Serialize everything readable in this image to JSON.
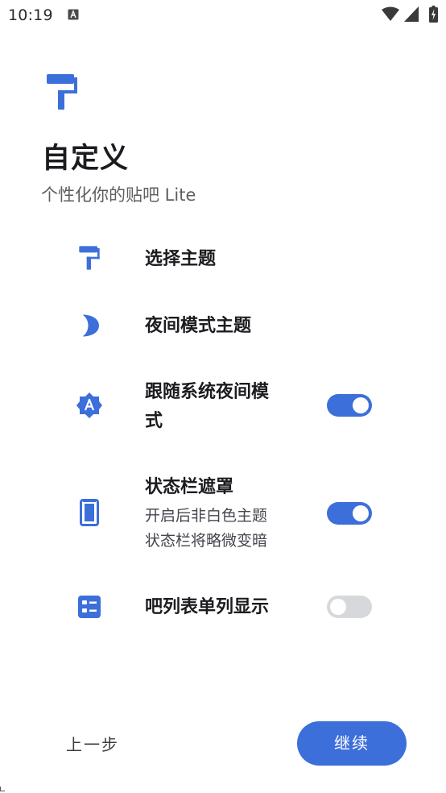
{
  "status_bar": {
    "time": "10:19",
    "notification_icon": "text-a-notification-icon",
    "wifi_icon": "wifi-icon",
    "signal_icon": "cell-signal-icon",
    "battery_icon": "battery-charging-icon"
  },
  "header": {
    "icon": "paint-roller-icon",
    "title": "自定义",
    "subtitle": "个性化你的贴吧 Lite"
  },
  "settings": [
    {
      "icon": "paint-roller-icon",
      "title": "选择主题"
    },
    {
      "icon": "moon-icon",
      "title": "夜间模式主题"
    },
    {
      "icon": "auto-brightness-icon",
      "title_line1": "跟随系统夜间模",
      "title_line2": "式",
      "enabled": true
    },
    {
      "icon": "phone-frame-icon",
      "title": "状态栏遮罩",
      "summary_line1": "开启后非白色主题",
      "summary_line2": "状态栏将略微变暗",
      "enabled": true
    },
    {
      "icon": "list-view-icon",
      "title": "吧列表单列显示",
      "enabled": false
    }
  ],
  "footer": {
    "back_label": "上一步",
    "continue_label": "继续"
  },
  "colors": {
    "accent": "#3d6fdb",
    "toggle_off": "#d7d8db",
    "title_text": "#1c1b1f",
    "secondary_text": "#5d5e62"
  }
}
